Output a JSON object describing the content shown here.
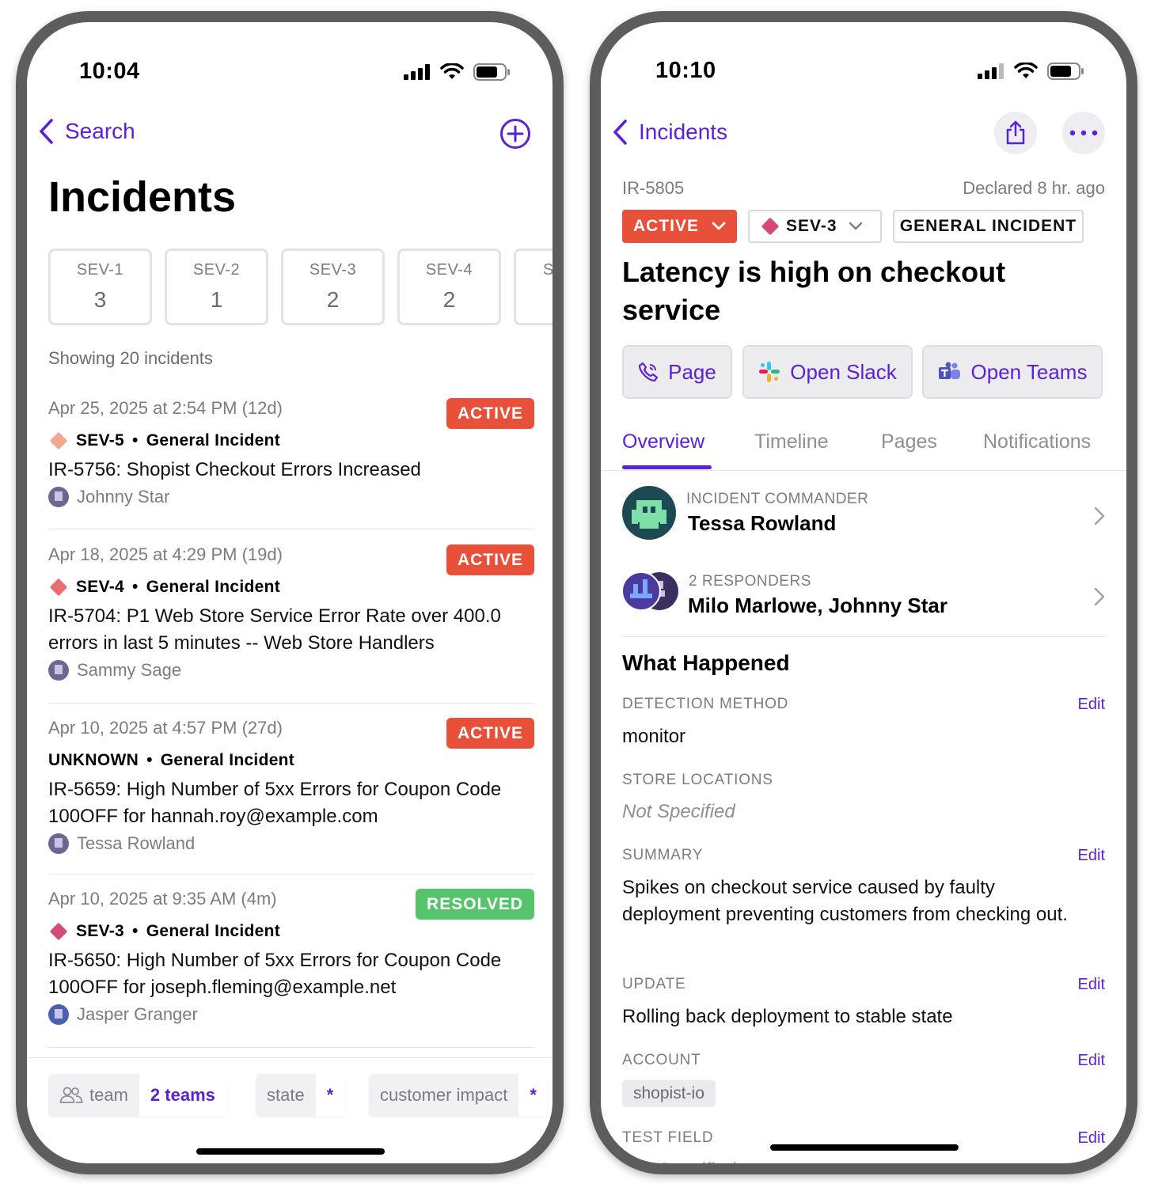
{
  "left": {
    "status_time": "10:04",
    "nav_back_label": "Search",
    "title": "Incidents",
    "severity_cards": [
      {
        "label": "SEV-1",
        "count": "3"
      },
      {
        "label": "SEV-2",
        "count": "1"
      },
      {
        "label": "SEV-3",
        "count": "2"
      },
      {
        "label": "SEV-4",
        "count": "2"
      },
      {
        "label": "S",
        "count": ""
      }
    ],
    "showing": "Showing 20 incidents",
    "incidents": [
      {
        "date": "Apr 25, 2025 at 2:54 PM (12d)",
        "status": "ACTIVE",
        "severity": "SEV-5",
        "type": "General Incident",
        "title": "IR-5756: Shopist Checkout Errors Increased",
        "owner": "Johnny Star",
        "sev_color": "#f2a98f"
      },
      {
        "date": "Apr 18, 2025 at 4:29 PM (19d)",
        "status": "ACTIVE",
        "severity": "SEV-4",
        "type": "General Incident",
        "title": "IR-5704: P1 Web Store Service Error Rate over 400.0 errors in last 5 minutes -- Web Store Handlers",
        "owner": "Sammy Sage",
        "sev_color": "#ec6d70"
      },
      {
        "date": "Apr 10, 2025 at 4:57 PM (27d)",
        "status": "ACTIVE",
        "severity": "UNKNOWN",
        "type": "General Incident",
        "title": "IR-5659: High Number of 5xx Errors for Coupon Code 100OFF for hannah.roy@example.com",
        "owner": "Tessa Rowland",
        "sev_color": ""
      },
      {
        "date": "Apr 10, 2025 at 9:35 AM (4m)",
        "status": "RESOLVED",
        "severity": "SEV-3",
        "type": "General Incident",
        "title": "IR-5650: High Number of 5xx Errors for Coupon Code 100OFF for joseph.fleming@example.net",
        "owner": "Jasper Granger",
        "sev_color": "#d54b73"
      }
    ],
    "filters": [
      {
        "key": "team",
        "value": "2 teams"
      },
      {
        "key": "state",
        "value": "*"
      },
      {
        "key": "customer impact",
        "value": "*"
      }
    ]
  },
  "right": {
    "status_time": "10:10",
    "nav_back_label": "Incidents",
    "incident_id": "IR-5805",
    "declared": "Declared 8 hr. ago",
    "state_pill": "ACTIVE",
    "severity_pill": "SEV-3",
    "type_pill": "GENERAL INCIDENT",
    "title": "Latency is high on checkout service",
    "actions": {
      "page": "Page",
      "slack": "Open Slack",
      "teams": "Open Teams"
    },
    "tabs": [
      "Overview",
      "Timeline",
      "Pages",
      "Notifications"
    ],
    "commander": {
      "label": "INCIDENT COMMANDER",
      "name": "Tessa Rowland"
    },
    "responders": {
      "label": "2 RESPONDERS",
      "names": "Milo Marlowe, Johnny Star"
    },
    "section_title": "What Happened",
    "edit_label": "Edit",
    "fields": {
      "detection_method": {
        "label": "DETECTION METHOD",
        "value": "monitor"
      },
      "store_locations": {
        "label": "STORE LOCATIONS",
        "value": "Not Specified"
      },
      "summary": {
        "label": "SUMMARY",
        "value": "Spikes on checkout service caused by faulty deployment preventing customers from checking out."
      },
      "update": {
        "label": "UPDATE",
        "value": "Rolling back deployment to stable state"
      },
      "account": {
        "label": "ACCOUNT",
        "value": "shopist-io"
      },
      "test_field": {
        "label": "TEST FIELD",
        "value": "Not Specified"
      }
    }
  },
  "colors": {
    "accent": "#5b21d6",
    "active": "#e8503a",
    "resolved": "#56c46a",
    "sev3": "#d54b73"
  }
}
